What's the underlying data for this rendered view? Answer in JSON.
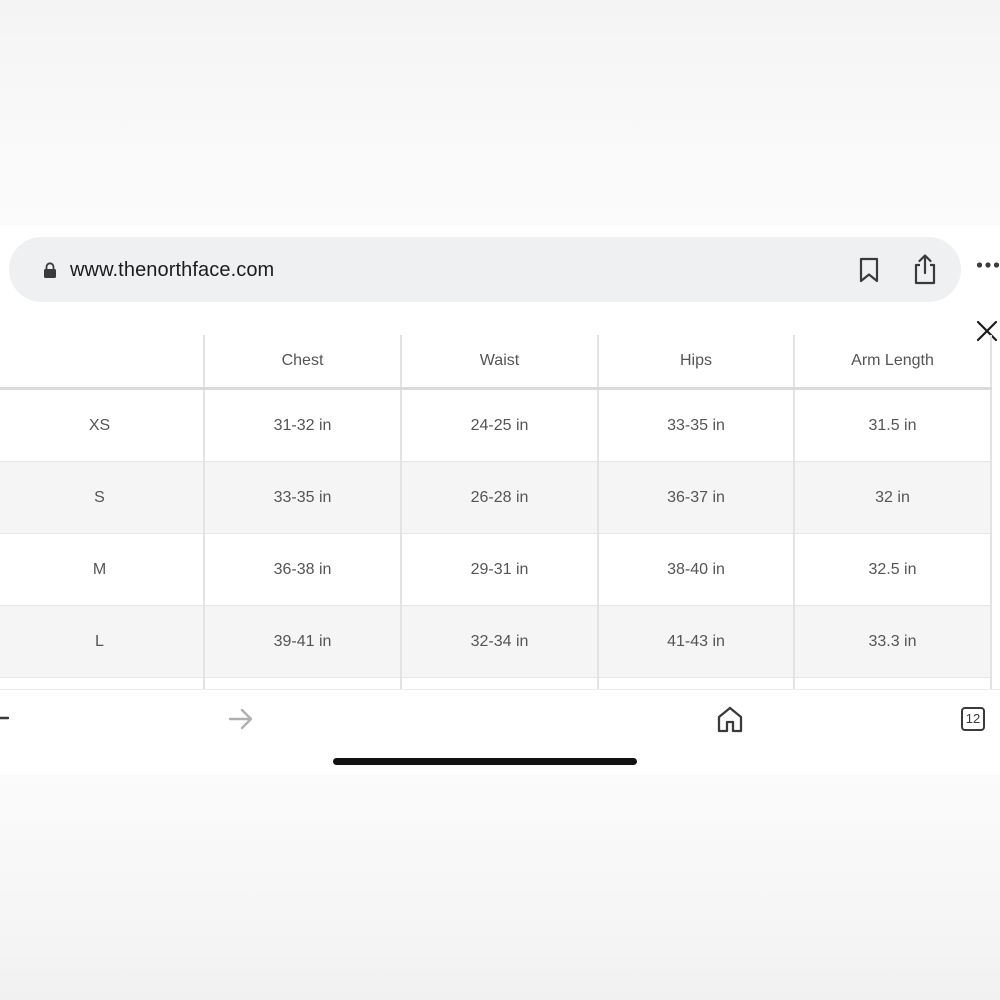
{
  "browser": {
    "url": "www.thenorthface.com",
    "tab_count": "12"
  },
  "size_chart": {
    "columns": [
      "",
      "Chest",
      "Waist",
      "Hips",
      "Arm Length"
    ],
    "rows": [
      [
        "XS",
        "31-32 in",
        "24-25 in",
        "33-35 in",
        "31.5 in"
      ],
      [
        "S",
        "33-35 in",
        "26-28 in",
        "36-37 in",
        "32 in"
      ],
      [
        "M",
        "36-38 in",
        "29-31 in",
        "38-40 in",
        "32.5 in"
      ],
      [
        "L",
        "39-41 in",
        "32-34 in",
        "41-43 in",
        "33.3 in"
      ]
    ]
  },
  "icons": {
    "lock": "lock-icon",
    "bookmark": "bookmark-icon",
    "share": "share-icon",
    "more": "more-icon",
    "close": "close-icon",
    "back": "back-arrow-icon",
    "forward": "forward-arrow-icon",
    "home": "home-icon",
    "tabs": "tabs-icon"
  },
  "colors": {
    "address_bar": "#eff0f2",
    "row_alt": "#f5f5f5",
    "text": "#555555",
    "home_indicator": "#111111"
  }
}
